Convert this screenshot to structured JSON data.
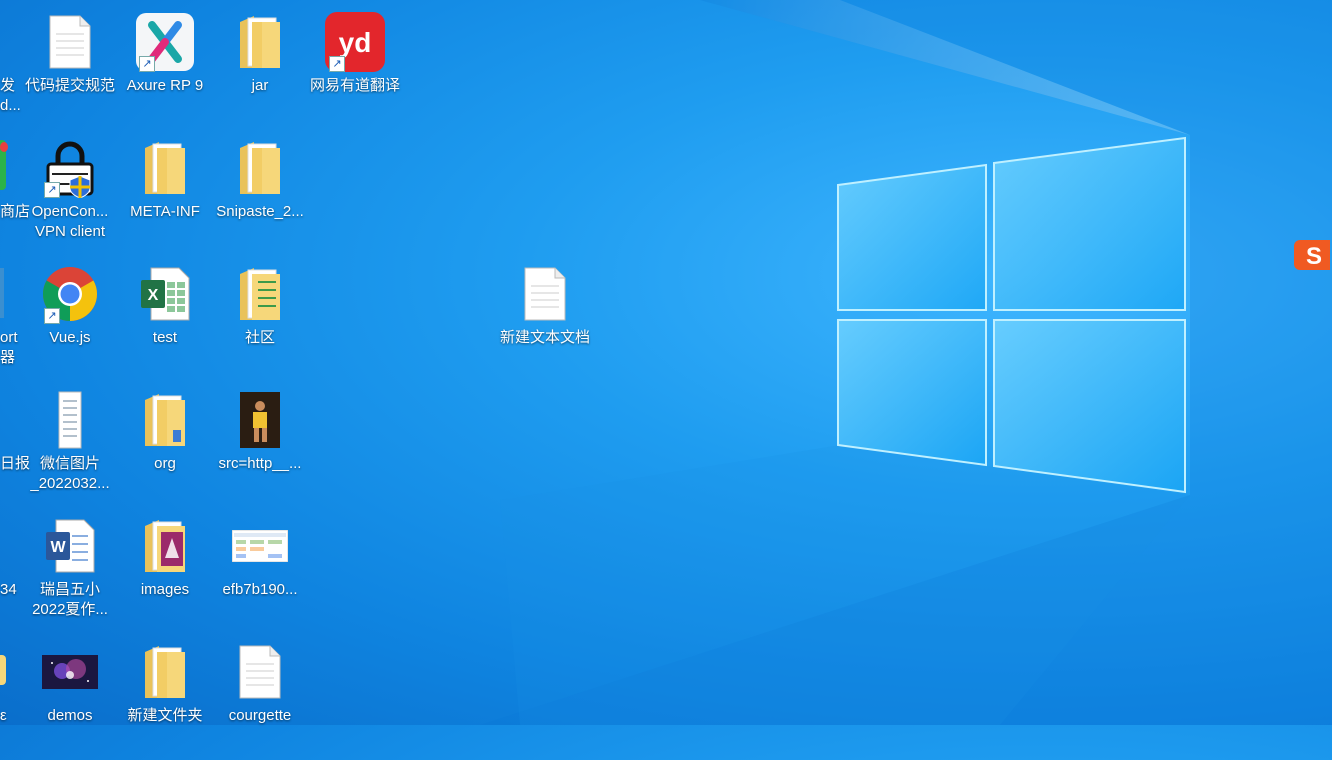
{
  "desktop": {
    "partial_labels": {
      "p1": "发",
      "p2": "d...",
      "p3": "商店",
      "p4": "ort",
      "p5": "器",
      "p6": "日报",
      "p7": "34",
      "p8": "ε"
    },
    "icons": {
      "code_rules": "代码提交规范",
      "axure": "Axure RP 9",
      "jar": "jar",
      "youdao": "网易有道翻译",
      "openconnect": "OpenCon...\nVPN client",
      "meta_inf": "META-INF",
      "snipaste": "Snipaste_2...",
      "vuejs": "Vue.js",
      "test": "test",
      "community": "社区",
      "new_text_doc": "新建文本文档",
      "wechat_pic": "微信图片\n_2022032...",
      "org": "org",
      "src_http": "src=http__...",
      "ruichang": "瑞昌五小\n2022夏作...",
      "images": "images",
      "efb7": "efb7b190...",
      "demos": "demos",
      "new_folder": "新建文件夹",
      "courgette": "courgette"
    }
  },
  "colors": {
    "desktop_accent": "#1f9df0",
    "folder": "#f6d77a"
  }
}
